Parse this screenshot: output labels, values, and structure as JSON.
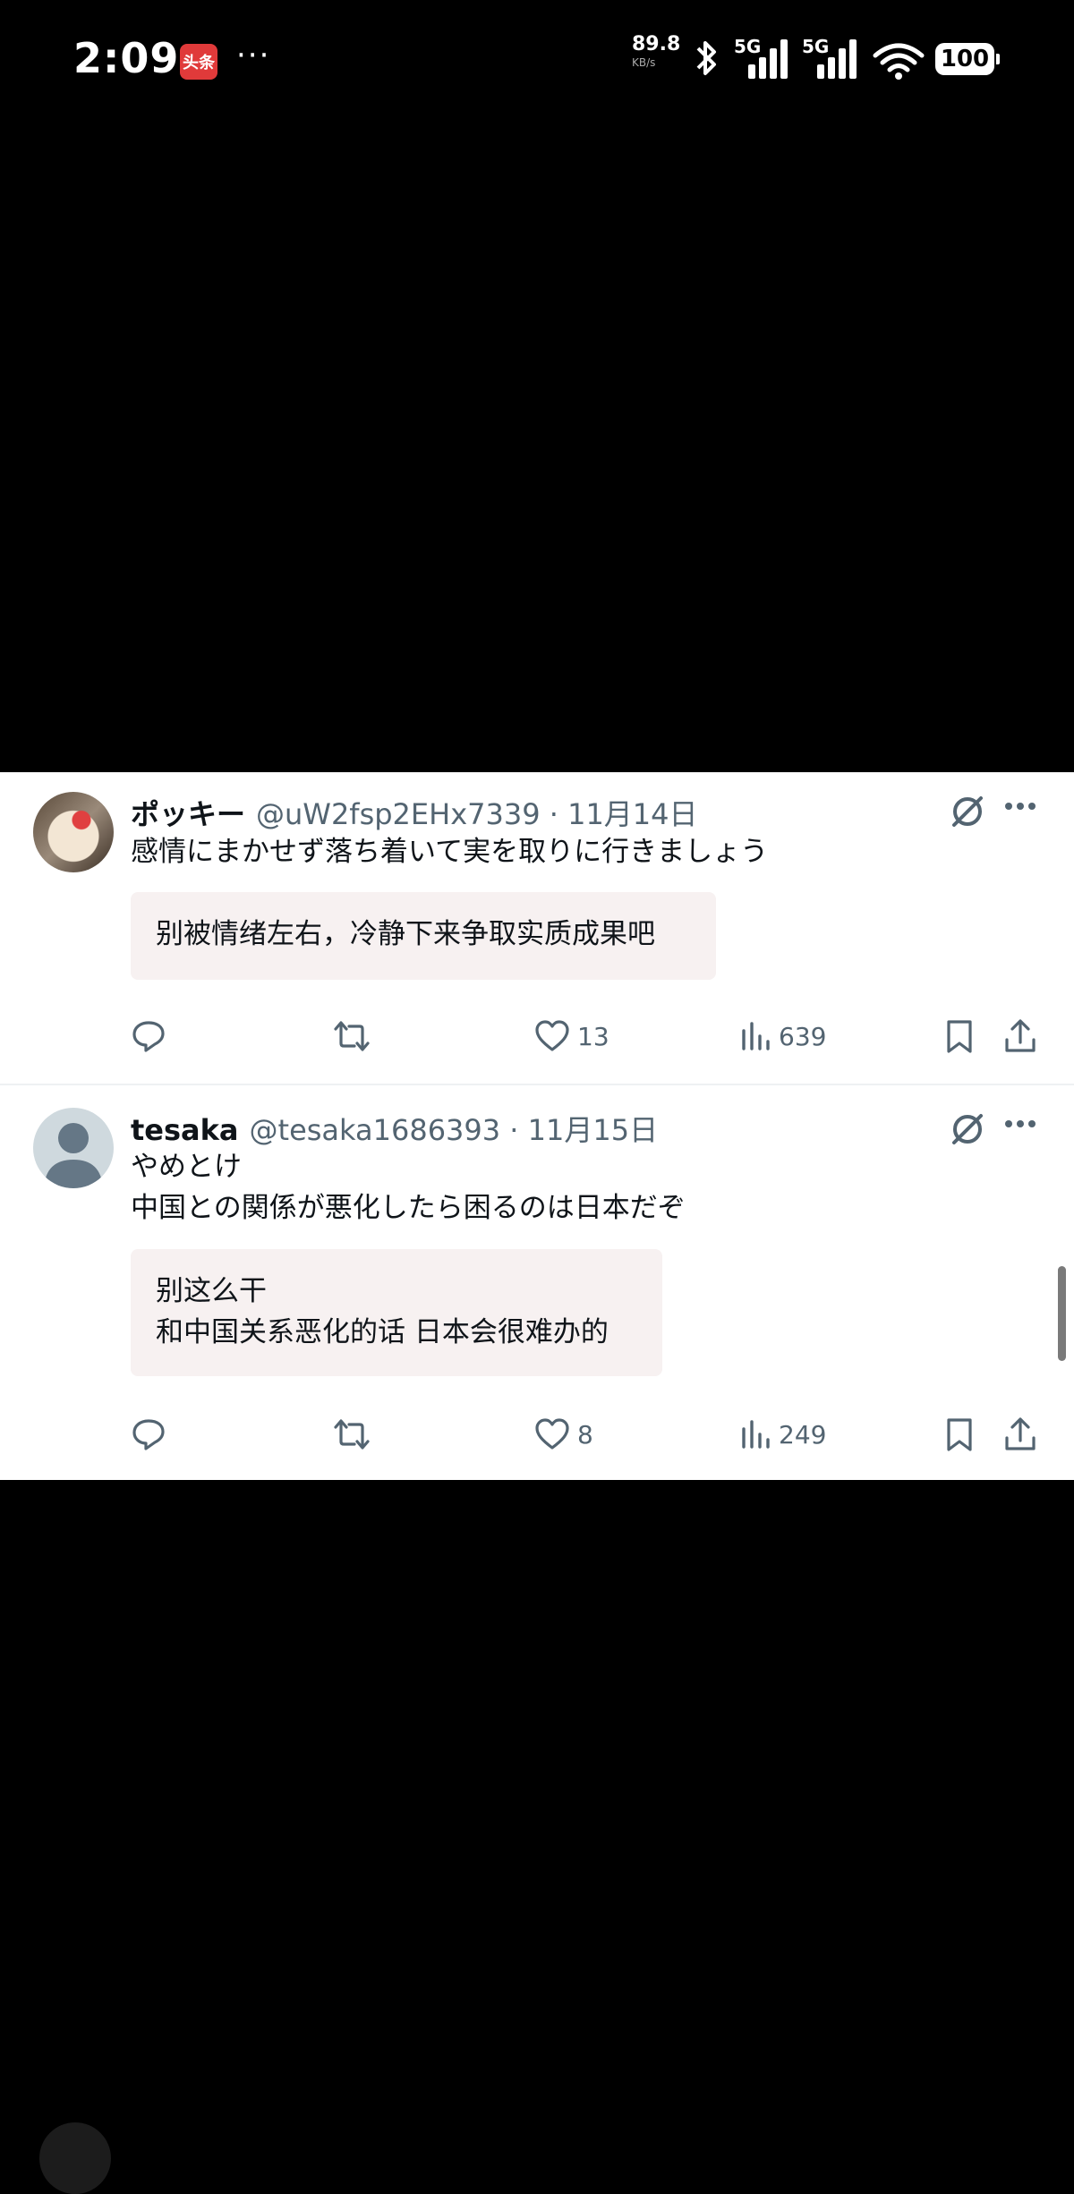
{
  "status_bar": {
    "time": "2:09",
    "app_badge": "头条",
    "more": "···",
    "net_speed": "89.8",
    "net_unit": "KB/s",
    "sim1": "5G",
    "sim2": "5G",
    "battery": "100"
  },
  "tweets": [
    {
      "name": "ポッキー",
      "handle": "@uW2fsp2EHx7339",
      "date": "· 11月14日",
      "text_lines": [
        "感情にまかせず落ち着いて実を取りに行きましょう"
      ],
      "translation_lines": [
        "别被情绪左右，冷静下来争取实质成果吧"
      ],
      "likes": "13",
      "views": "639"
    },
    {
      "name": "tesaka",
      "handle": "@tesaka1686393",
      "date": "· 11月15日",
      "text_lines": [
        "やめとけ",
        "中国との関係が悪化したら困るのは日本だぞ"
      ],
      "translation_lines": [
        "别这么干",
        "和中国关系恶化的话 日本会很难办的"
      ],
      "likes": "8",
      "views": "249"
    }
  ],
  "icons": {
    "reply": "reply-icon",
    "retweet": "retweet-icon",
    "like": "heart-icon",
    "views": "views-icon",
    "bookmark": "bookmark-icon",
    "share": "share-icon",
    "grok": "grok-icon",
    "menu": "more-options-icon"
  },
  "colors": {
    "text_primary": "#0f1419",
    "text_secondary": "#536471",
    "translation_bg": "#f7f1f1"
  }
}
